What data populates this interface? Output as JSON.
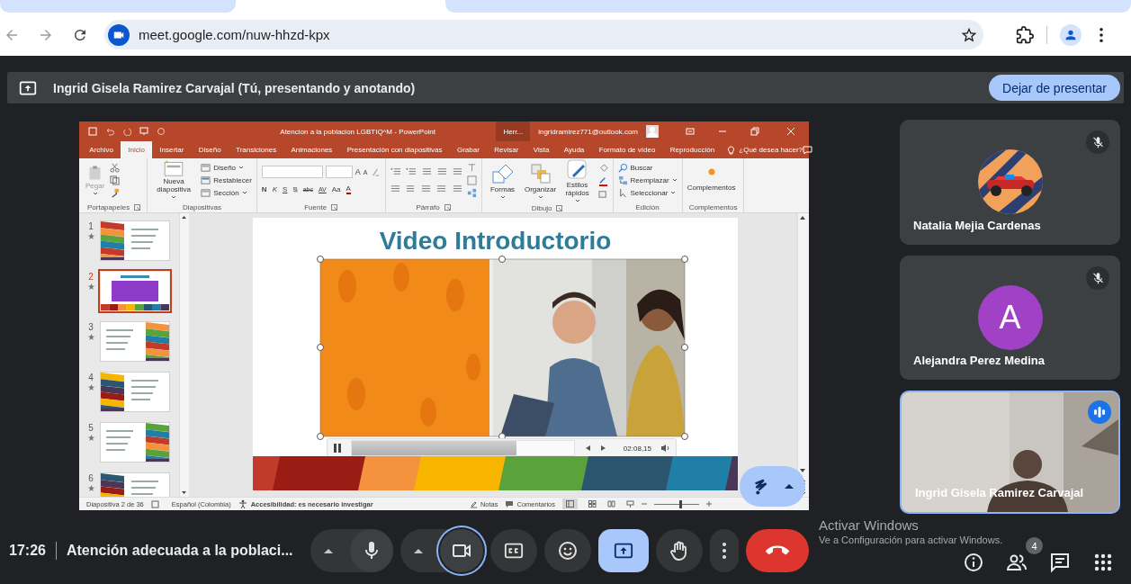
{
  "browser": {
    "url": "meet.google.com/nuw-hhzd-kpx"
  },
  "banner": {
    "text": "Ingrid Gisela Ramirez Carvajal (Tú, presentando y anotando)",
    "button": "Dejar de presentar"
  },
  "powerpoint": {
    "title": "Atencion a la poblacion LGBTIQ^M  -  PowerPoint",
    "context_label": "Herr...",
    "account": "ingridramirez771@outlook.com",
    "tabs": [
      {
        "label": "Archivo",
        "selected": false
      },
      {
        "label": "Inicio",
        "selected": true
      },
      {
        "label": "Insertar",
        "selected": false
      },
      {
        "label": "Diseño",
        "selected": false
      },
      {
        "label": "Transiciones",
        "selected": false
      },
      {
        "label": "Animaciones",
        "selected": false
      },
      {
        "label": "Presentación con diapositivas",
        "selected": false
      },
      {
        "label": "Grabar",
        "selected": false
      },
      {
        "label": "Revisar",
        "selected": false
      },
      {
        "label": "Vista",
        "selected": false
      },
      {
        "label": "Ayuda",
        "selected": false
      },
      {
        "label": "Formato de vídeo",
        "selected": false
      },
      {
        "label": "Reproducción",
        "selected": false
      }
    ],
    "tell_me": "¿Qué desea hacer?",
    "ribbon": [
      {
        "kind": "clipboard",
        "label": "Portapapeles",
        "launcher": true,
        "items": [
          {
            "label": "Pegar",
            "disabled": true
          }
        ]
      },
      {
        "kind": "slides",
        "label": "Diapositivas",
        "launcher": false,
        "items": [
          {
            "label": "Nueva diapositiva",
            "dropdown": true
          },
          {
            "label": "Diseño",
            "dropdown": true
          },
          {
            "label": "Restablecer",
            "dropdown": false
          },
          {
            "label": "Sección",
            "dropdown": true
          }
        ]
      },
      {
        "kind": "font",
        "label": "Fuente",
        "launcher": true,
        "glyphs": [
          "A",
          "A",
          "N",
          "K",
          "S",
          "S",
          "abc",
          "AV",
          "Aa",
          "A"
        ]
      },
      {
        "kind": "paragraph",
        "label": "Párrafo",
        "launcher": true
      },
      {
        "kind": "drawing",
        "label": "Dibujo",
        "launcher": true,
        "items": [
          {
            "label": "Formas",
            "dropdown": true
          },
          {
            "label": "Organizar",
            "dropdown": true
          },
          {
            "label": "Estilos rápidos",
            "dropdown": true
          }
        ]
      },
      {
        "kind": "editing",
        "label": "Edición",
        "launcher": false,
        "items": [
          {
            "label": "Buscar",
            "dropdown": false
          },
          {
            "label": "Reemplazar",
            "dropdown": true
          },
          {
            "label": "Seleccionar",
            "dropdown": true
          }
        ]
      },
      {
        "kind": "addins",
        "label": "Complementos",
        "launcher": false,
        "items": [
          {
            "label": "Complementos",
            "dropdown": false
          }
        ]
      }
    ],
    "thumbnails": [
      {
        "number": "1",
        "kind": "left",
        "selected": false
      },
      {
        "number": "2",
        "kind": "video",
        "selected": true
      },
      {
        "number": "3",
        "kind": "right",
        "selected": false
      },
      {
        "number": "4",
        "kind": "left",
        "selected": false
      },
      {
        "number": "5",
        "kind": "right",
        "selected": false
      },
      {
        "number": "6",
        "kind": "left",
        "selected": false
      }
    ],
    "slide": {
      "title": "Video Introductorio",
      "video": {
        "playing": true,
        "level": 0.74,
        "time": "02:08,15"
      }
    },
    "status": {
      "slide": "Diapositiva 2 de 36",
      "language": "Español (Colombia)",
      "accessibility": "Accesibilidad: es necesario investigar",
      "notes": "Notas",
      "comments": "Comentarios",
      "zoom": {
        "level": 0.55
      }
    }
  },
  "participants": [
    {
      "name": "Natalia Mejia Cardenas",
      "kind": "picture",
      "muted": true,
      "speaking": false
    },
    {
      "name": "Alejandra Perez Medina",
      "kind": "initial",
      "initial": "A",
      "color": "#a142c6",
      "muted": true,
      "speaking": false
    },
    {
      "name": "Ingrid Gisela Ramirez Carvajal",
      "kind": "video",
      "muted": false,
      "speaking": true
    }
  ],
  "meeting": {
    "time": "17:26",
    "title": "Atención adecuada a la poblaci...",
    "people_count": "4",
    "controls": [
      {
        "kind": "mic",
        "active": false,
        "focused": false
      },
      {
        "kind": "camera",
        "active": false,
        "focused": true
      },
      {
        "kind": "captions",
        "active": false,
        "focused": false
      },
      {
        "kind": "reactions",
        "active": false,
        "focused": false
      },
      {
        "kind": "present",
        "active": true,
        "focused": false
      },
      {
        "kind": "hand",
        "active": false,
        "focused": false
      },
      {
        "kind": "more",
        "active": false,
        "focused": false
      },
      {
        "kind": "leave",
        "active": false,
        "focused": false
      }
    ]
  },
  "windows_notice": {
    "title": "Activar Windows",
    "text": "Ve a Configuración para activar Windows."
  }
}
